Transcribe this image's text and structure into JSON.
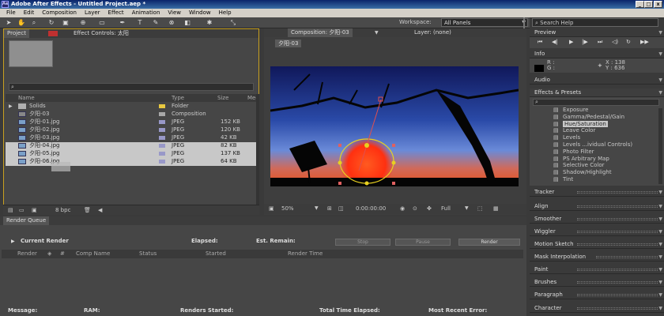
{
  "window": {
    "title": "Adobe After Effects - Untitled Project.aep *",
    "min": "_",
    "max": "□",
    "close": "x"
  },
  "menu": [
    "File",
    "Edit",
    "Composition",
    "Layer",
    "Effect",
    "Animation",
    "View",
    "Window",
    "Help"
  ],
  "toolbar": {
    "workspace_label": "Workspace:",
    "workspace_value": "All Panels",
    "search_placeholder": "Search Help"
  },
  "project": {
    "tab_project": "Project",
    "tab_effect_controls": "Effect Controls: 太阳",
    "search_icon": "⌕",
    "columns": {
      "name": "Name",
      "type": "Type",
      "size": "Size",
      "media": "Med"
    },
    "items": [
      {
        "name": "Solids",
        "type": "Folder",
        "size": "",
        "color": "#e8c840"
      },
      {
        "name": "夕阳-03",
        "type": "Composition",
        "size": "",
        "color": "#a8a8a8"
      },
      {
        "name": "夕阳-01.jpg",
        "type": "JPEG",
        "size": "152 KB",
        "color": "#9898c8"
      },
      {
        "name": "夕阳-02.jpg",
        "type": "JPEG",
        "size": "120 KB",
        "color": "#9898c8"
      },
      {
        "name": "夕阳-03.jpg",
        "type": "JPEG",
        "size": "42 KB",
        "color": "#9898c8"
      },
      {
        "name": "夕阳-04.jpg",
        "type": "JPEG",
        "size": "82 KB",
        "color": "#9898c8"
      },
      {
        "name": "夕阳-05.jpg",
        "type": "JPEG",
        "size": "137 KB",
        "color": "#9898c8"
      },
      {
        "name": "夕阳-06.jpg",
        "type": "JPEG",
        "size": "64 KB",
        "color": "#9898c8"
      }
    ],
    "bpc": "8 bpc"
  },
  "composition": {
    "tab": "Composition: 夕阳-03",
    "layer_tab": "Layer: (none)",
    "comp_chip": "夕阳-03",
    "zoom": "50%",
    "timecode": "0:00:00:00",
    "resolution": "Full"
  },
  "right": {
    "preview": "Preview",
    "info": "Info",
    "info_r": "R :",
    "info_g": "G :",
    "info_x": "X : 138",
    "info_y": "Y : 636",
    "audio": "Audio",
    "effects_presets": "Effects & Presets",
    "effects": [
      "Exposure",
      "Gamma/Pedestal/Gain",
      "Hue/Saturation",
      "Leave Color",
      "Levels",
      "Levels ...ividual Controls)",
      "Photo Filter",
      "PS Arbitrary Map",
      "Selective Color",
      "Shadow/Highlight",
      "Tint"
    ],
    "selected_effect": "Hue/Saturation",
    "panels": [
      "Tracker",
      "Align",
      "Smoother",
      "Wiggler",
      "Motion Sketch",
      "Mask Interpolation",
      "Paint",
      "Brushes",
      "Paragraph",
      "Character"
    ]
  },
  "render_queue": {
    "tab": "Render Queue",
    "current_render": "Current Render",
    "elapsed": "Elapsed:",
    "est_remain": "Est. Remain:",
    "stop": "Stop",
    "pause": "Pause",
    "render": "Render",
    "columns": [
      "Render",
      "#",
      "Comp Name",
      "Status",
      "Started",
      "Render Time"
    ],
    "footer": {
      "message": "Message:",
      "ram": "RAM:",
      "renders_started": "Renders Started:",
      "total_time": "Total Time Elapsed:",
      "recent_error": "Most Recent Error:"
    }
  }
}
